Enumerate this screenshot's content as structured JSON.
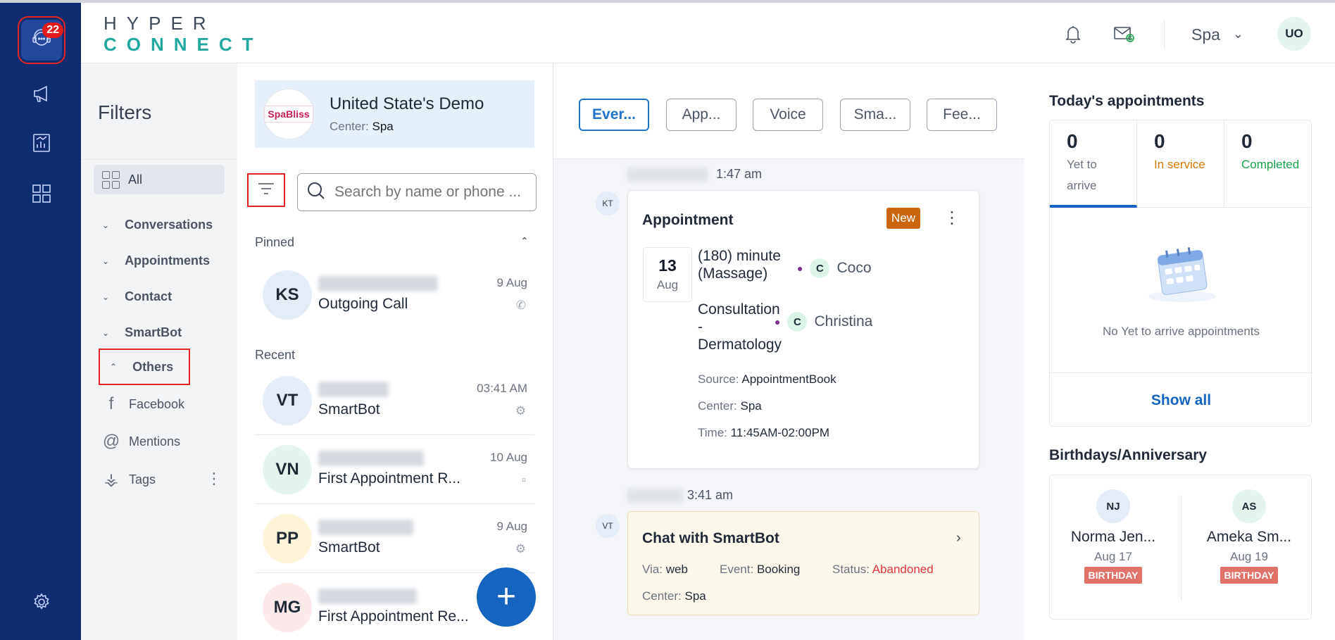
{
  "nav": {
    "badge_count": "22"
  },
  "header": {
    "logo_line1": "HYPER",
    "logo_line2": "CONNECT",
    "location": "Spa",
    "avatar_initials": "UO"
  },
  "filters": {
    "title": "Filters",
    "all_label": "All",
    "groups": [
      "Conversations",
      "Appointments",
      "Contact",
      "SmartBot",
      "Others"
    ],
    "items": [
      "Facebook",
      "Mentions",
      "Tags"
    ]
  },
  "account": {
    "logo_text": "SpaBliss",
    "name": "United State's Demo",
    "center_key": "Center:",
    "center_val": "Spa"
  },
  "search": {
    "placeholder": "Search by name or phone ..."
  },
  "list": {
    "pinned_label": "Pinned",
    "recent_label": "Recent",
    "items": [
      {
        "initials": "KS",
        "subtitle": "Outgoing Call",
        "date": "9 Aug"
      },
      {
        "initials": "VT",
        "subtitle": "SmartBot",
        "date": "03:41 AM"
      },
      {
        "initials": "VN",
        "subtitle": "First Appointment R...",
        "date": "10 Aug"
      },
      {
        "initials": "PP",
        "subtitle": "SmartBot",
        "date": "9 Aug"
      },
      {
        "initials": "MG",
        "subtitle": "First Appointment Re...",
        "date": ""
      }
    ],
    "fab": "+"
  },
  "timeline": {
    "chips": [
      "Ever...",
      "App...",
      "Voice",
      "Sma...",
      "Fee..."
    ],
    "event1": {
      "avatar": "KT",
      "time": "1:47 am",
      "title": "Appointment",
      "badge": "New",
      "day": "13",
      "month": "Aug",
      "service1": "(180) minute (Massage)",
      "staff1_initial": "C",
      "staff1": "Coco",
      "service2": "Consultation - Dermatology",
      "staff2_initial": "C",
      "staff2": "Christina",
      "source_key": "Source:",
      "source_val": "AppointmentBook",
      "center_key": "Center:",
      "center_val": "Spa",
      "time_key": "Time:",
      "time_val": "11:45AM-02:00PM"
    },
    "event2": {
      "avatar": "VT",
      "time": "3:41 am",
      "title": "Chat with SmartBot",
      "via_key": "Via:",
      "via_val": "web",
      "event_key": "Event:",
      "event_val": "Booking",
      "status_key": "Status:",
      "status_val": "Abandoned",
      "center_key": "Center:",
      "center_val": "Spa"
    }
  },
  "appointments": {
    "title": "Today's appointments",
    "tabs": [
      {
        "count": "0",
        "label": "Yet to arrive"
      },
      {
        "count": "0",
        "label": "In service"
      },
      {
        "count": "0",
        "label": "Completed"
      }
    ],
    "empty_text": "No Yet to arrive appointments",
    "show_all": "Show all"
  },
  "birthdays": {
    "title": "Birthdays/Anniversary",
    "people": [
      {
        "initials": "NJ",
        "name": "Norma Jen...",
        "date": "Aug 17",
        "tag": "BIRTHDAY"
      },
      {
        "initials": "AS",
        "name": "Ameka Sm...",
        "date": "Aug 19",
        "tag": "BIRTHDAY"
      }
    ]
  },
  "colors": {
    "nav_bg": "#0f2c70",
    "accent": "#1565c0",
    "new_badge": "#c9660e",
    "abandoned": "#e0353a"
  }
}
